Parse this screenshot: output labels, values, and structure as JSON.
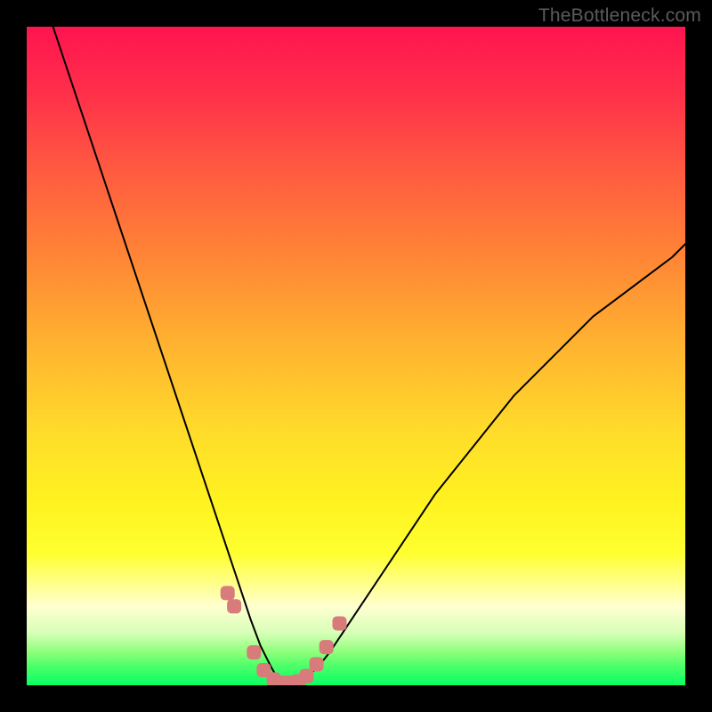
{
  "watermark": "TheBottleneck.com",
  "chart_data": {
    "type": "line",
    "title": "",
    "xlabel": "",
    "ylabel": "",
    "xlim": [
      0,
      100
    ],
    "ylim": [
      0,
      100
    ],
    "grid": false,
    "legend": false,
    "series": [
      {
        "name": "curve",
        "x": [
          4,
          6,
          8,
          10,
          12,
          14,
          16,
          18,
          20,
          22,
          24,
          26,
          28,
          30,
          32,
          34,
          35.5,
          37,
          38,
          39,
          40,
          42,
          44,
          46,
          48,
          50,
          54,
          58,
          62,
          66,
          70,
          74,
          78,
          82,
          86,
          90,
          94,
          98,
          100
        ],
        "y": [
          100,
          94,
          88,
          82,
          76,
          70,
          64,
          58,
          52,
          46,
          40,
          34,
          28,
          22,
          16,
          10,
          6,
          3,
          1.2,
          0.5,
          0.5,
          1,
          2.5,
          5,
          8,
          11,
          17,
          23,
          29,
          34,
          39,
          44,
          48,
          52,
          56,
          59,
          62,
          65,
          67
        ]
      }
    ],
    "markers": {
      "name": "near-minimum-markers",
      "color": "#d77b7b",
      "x": [
        30.5,
        31.5,
        34.5,
        36,
        37.5,
        38.8,
        40,
        41.2,
        42.5,
        44,
        45.5,
        47.5
      ],
      "y": [
        14,
        12,
        5,
        2.3,
        0.9,
        0.4,
        0.4,
        0.6,
        1.4,
        3.2,
        5.8,
        9.4
      ]
    },
    "gradient_colors": {
      "top": "#ff1450",
      "mid": "#fff220",
      "bottom": "#0aff60"
    }
  }
}
